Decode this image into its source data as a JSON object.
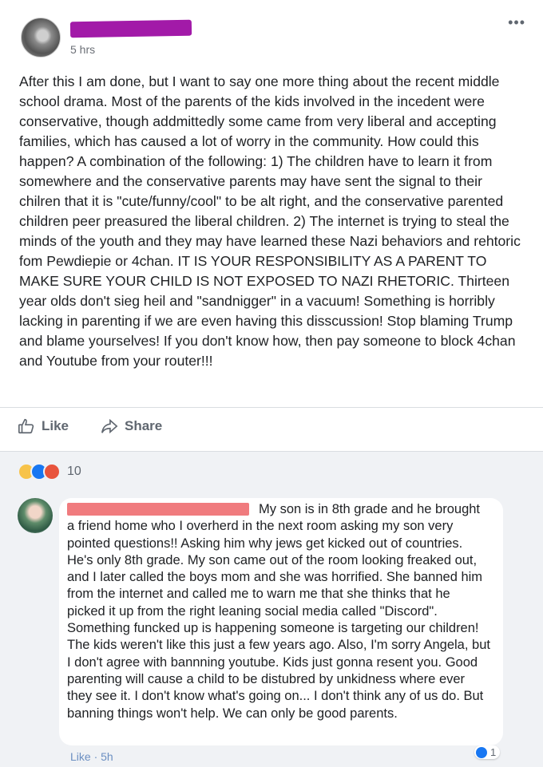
{
  "post": {
    "time": "5 hrs",
    "more_label": "•••",
    "text": "After this I am done, but I want to say one more thing about the recent middle school drama. Most of the parents of the kids involved in the incedent were conservative, though addmittedly some came from very liberal and accepting families, which has caused a lot of worry in the community. How could this happen? A combination of the following: 1) The children have to learn it from somewhere and the conservative parents may have sent the signal to their chilren that it is \"cute/funny/cool\" to be alt right, and the conservative parented children peer preasured the liberal children. 2) The internet is trying to steal the minds of the youth and they may have learned these Nazi behaviors and rehtoric fom Pewdiepie or 4chan. IT IS YOUR RESPONSIBILITY AS A PARENT TO MAKE SURE YOUR CHILD IS NOT EXPOSED TO NAZI RHETORIC. Thirteen year olds don't sieg heil and \"sandnigger\" in a vacuum! Something is horribly lacking in parenting if we are even having this disscussion! Stop blaming Trump and blame yourselves! If you don't know how, then pay someone to block 4chan and Youtube from your router!!!"
  },
  "actions": {
    "like_label": "Like",
    "share_label": "Share"
  },
  "reactions": {
    "count": "10",
    "types": [
      "sad",
      "like",
      "angry"
    ],
    "colors": {
      "sad": "#f7c34a",
      "like": "#1877f2",
      "angry": "#e8543d"
    }
  },
  "comment": {
    "text": "My son is in 8th grade and he brought a friend home who I overherd in the next room asking my son very pointed questions!! Asking him why jews get kicked out of countries. He's only 8th grade. My son came out of the room looking freaked out, and I later called the boys mom and she was horrified. She banned him from the internet and called me to warn me that she thinks that he picked it up from the right leaning social media called \"Discord\". Something funcked up is happening someone is targeting our children! The kids weren't like this just a few years ago. Also, I'm sorry Angela, but I don't agree with bannning youtube. Kids just gonna resent you. Good parenting will cause a child to be distubred by unkidness where ever they see it. I don't know what's going on... I don't think any of us do. But banning things won't help. We can only be good parents.",
    "like_label": "Like",
    "time": "5h",
    "reaction_count": "1"
  }
}
